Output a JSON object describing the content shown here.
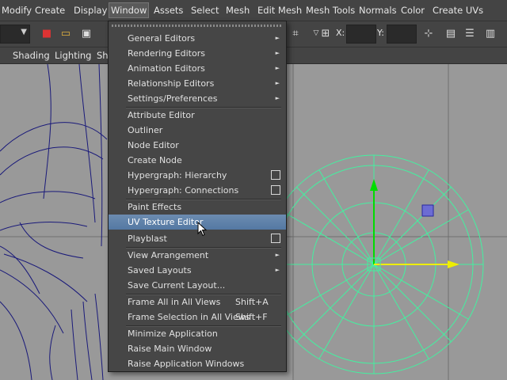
{
  "menubar": {
    "items": [
      "Modify",
      "Create",
      "Display",
      "Window",
      "Assets",
      "Select",
      "Mesh",
      "Edit Mesh",
      "Mesh Tools",
      "Normals",
      "Color",
      "Create UVs"
    ]
  },
  "toolbar": {
    "x_label": "X:",
    "y_label": "Y:"
  },
  "panel_menu": {
    "items": [
      "Shading",
      "Lighting",
      "Sho"
    ]
  },
  "window_menu": {
    "items": [
      {
        "label": "General Editors",
        "arrow": true
      },
      {
        "label": "Rendering Editors",
        "arrow": true
      },
      {
        "label": "Animation Editors",
        "arrow": true
      },
      {
        "label": "Relationship Editors",
        "arrow": true
      },
      {
        "label": "Settings/Preferences",
        "arrow": true
      },
      {
        "label": "Attribute Editor"
      },
      {
        "label": "Outliner"
      },
      {
        "label": "Node Editor"
      },
      {
        "label": "Create Node"
      },
      {
        "label": "Hypergraph: Hierarchy",
        "option": true
      },
      {
        "label": "Hypergraph: Connections",
        "option": true
      },
      {
        "label": "Paint Effects"
      },
      {
        "label": "UV Texture Editor",
        "highlighted": true
      },
      {
        "label": "Playblast",
        "option": true
      },
      {
        "label": "View Arrangement",
        "arrow": true
      },
      {
        "label": "Saved Layouts",
        "arrow": true
      },
      {
        "label": "Save Current Layout..."
      },
      {
        "label": "Frame All in All Views",
        "shortcut": "Shift+A"
      },
      {
        "label": "Frame Selection in All Views",
        "shortcut": "Shift+F"
      },
      {
        "label": "Minimize Application"
      },
      {
        "label": "Raise Main Window"
      },
      {
        "label": "Raise Application Windows"
      }
    ]
  },
  "colors": {
    "highlight": "#5a7ca6",
    "viewport_bg": "#999999",
    "wire_blue": "#1a1a7a",
    "wire_green": "#44f0a0",
    "manip_green": "#00dd00",
    "manip_yellow": "#eeee00"
  }
}
